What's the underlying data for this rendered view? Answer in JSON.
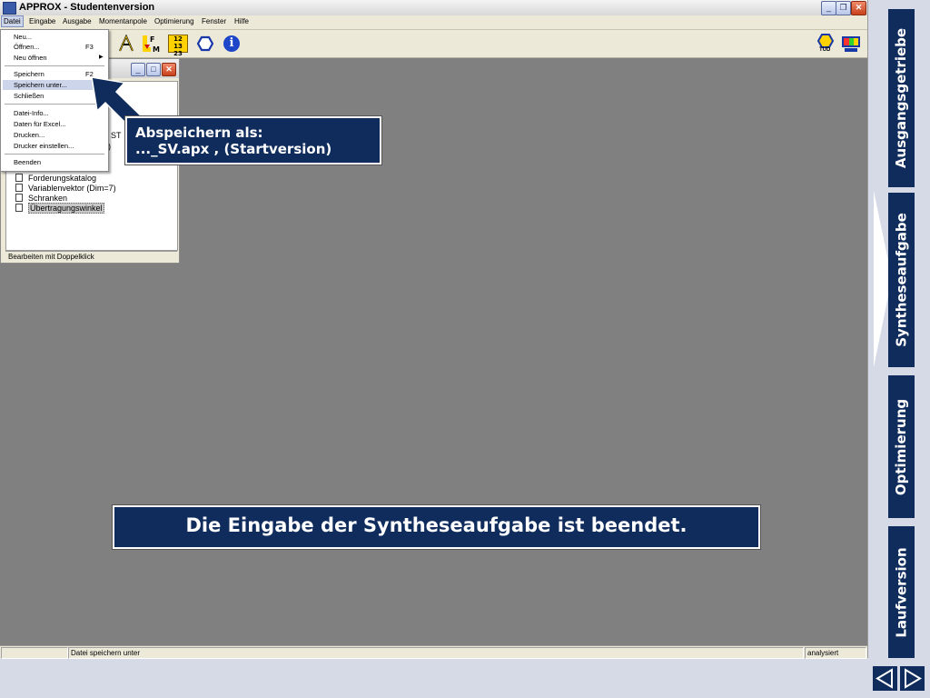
{
  "window": {
    "title": "APPROX - Studentenversion"
  },
  "menubar": {
    "items": [
      "Datei",
      "Eingabe",
      "Ausgabe",
      "Momentanpole",
      "Optimierung",
      "Fenster",
      "Hilfe"
    ]
  },
  "toolbar": {
    "badge_top": "12 13",
    "badge_bottom": "23",
    "info": "i",
    "tud_label": "TUD"
  },
  "file_menu": {
    "items": [
      {
        "label": "Neu...",
        "shortcut": ""
      },
      {
        "label": "Öffnen...",
        "shortcut": "F3"
      },
      {
        "label": "Neu öffnen",
        "shortcut": ""
      },
      {
        "label": "Speichern",
        "shortcut": "F2"
      },
      {
        "label": "Speichern unter...",
        "shortcut": ""
      },
      {
        "label": "Schließen",
        "shortcut": ""
      },
      {
        "label": "Datei-Info...",
        "shortcut": ""
      },
      {
        "label": "Daten für Excel...",
        "shortcut": ""
      },
      {
        "label": "Drucken...",
        "shortcut": ""
      },
      {
        "label": "Drucker einstellen...",
        "shortcut": ""
      },
      {
        "label": "Beenden",
        "shortcut": ""
      }
    ]
  },
  "child_window": {
    "partial_1": "ST",
    "partial_2": ")",
    "tree_items": [
      "Forderungskatalog",
      "Variablenvektor (Dim=7)",
      "Schranken",
      "Übertragungswinkel"
    ],
    "status": "Bearbeiten mit Doppelklick"
  },
  "statusbar": {
    "left": "",
    "middle": "Datei speichern unter",
    "right": "analysiert"
  },
  "callouts": {
    "save_line1": "Abspeichern als:",
    "save_line2": "..._SV.apx , (Startversion)",
    "done": "Die Eingabe der Syntheseaufgabe ist beendet."
  },
  "side_tabs": [
    "Ausgangsgetriebe",
    "Syntheseaufgabe",
    "Optimierung",
    "Laufversion"
  ],
  "colors": {
    "navy": "#0f2c5c",
    "workspace": "#808080",
    "menu_highlight": "#cdd5ea"
  }
}
